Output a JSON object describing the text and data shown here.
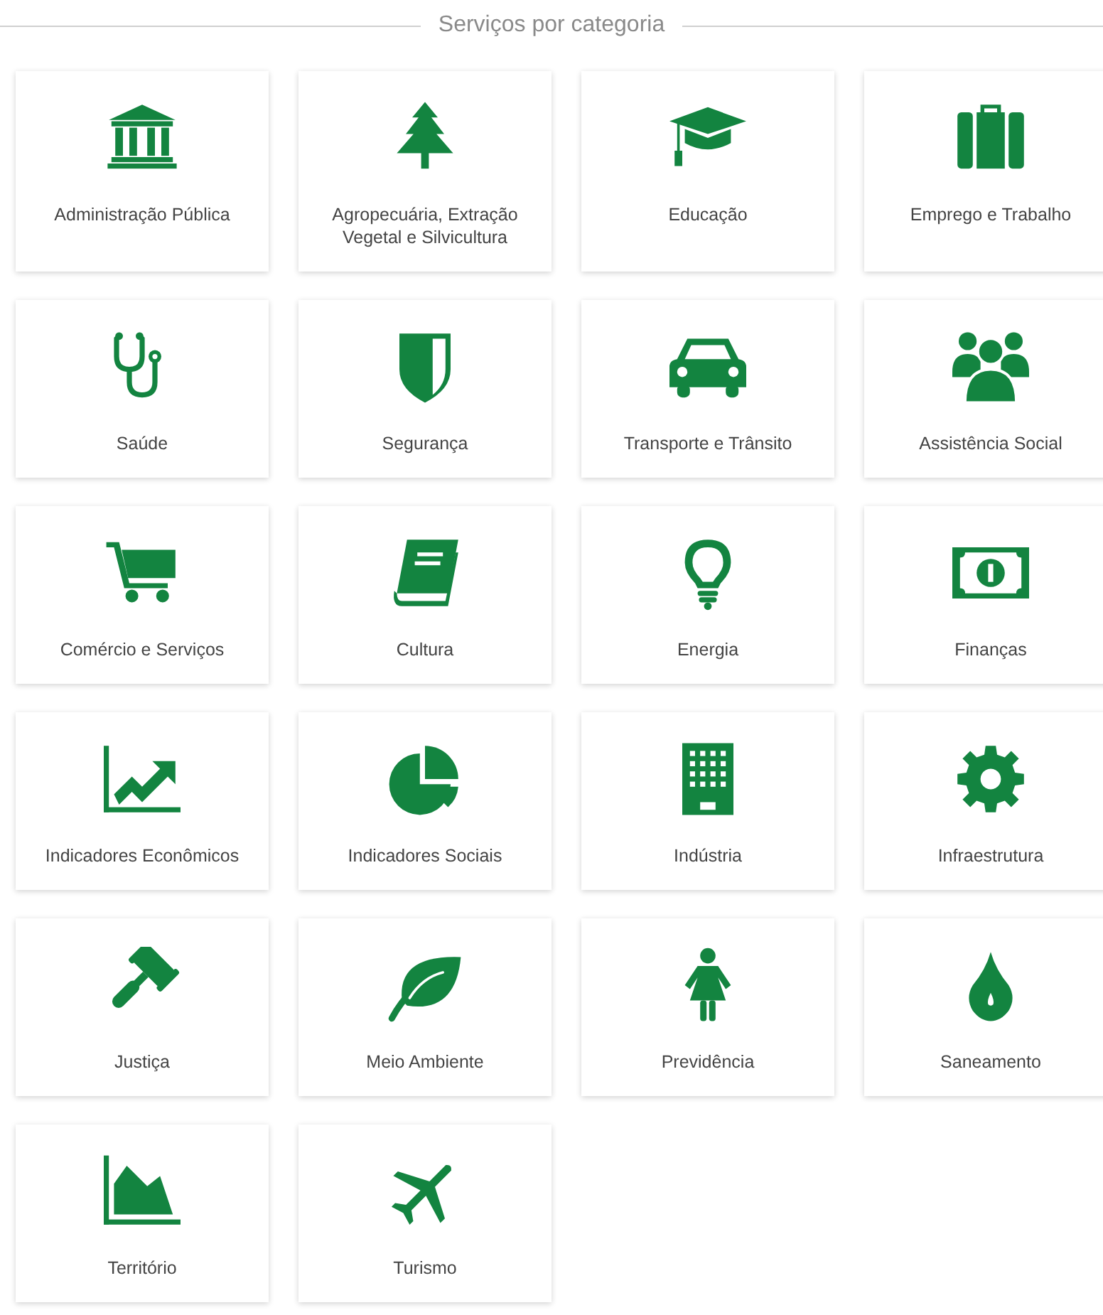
{
  "heading": "Serviços por categoria",
  "categories": [
    {
      "label": "Administração Pública"
    },
    {
      "label": "Agropecuária, Extração Vegetal e Silvicultura"
    },
    {
      "label": "Educação"
    },
    {
      "label": "Emprego e Trabalho"
    },
    {
      "label": "Saúde"
    },
    {
      "label": "Segurança"
    },
    {
      "label": "Transporte e Trânsito"
    },
    {
      "label": "Assistência Social"
    },
    {
      "label": "Comércio e Serviços"
    },
    {
      "label": "Cultura"
    },
    {
      "label": "Energia"
    },
    {
      "label": "Finanças"
    },
    {
      "label": "Indicadores Econômicos"
    },
    {
      "label": "Indicadores Sociais"
    },
    {
      "label": "Indústria"
    },
    {
      "label": "Infraestrutura"
    },
    {
      "label": "Justiça"
    },
    {
      "label": "Meio Ambiente"
    },
    {
      "label": "Previdência"
    },
    {
      "label": "Saneamento"
    },
    {
      "label": "Território"
    },
    {
      "label": "Turismo"
    }
  ]
}
